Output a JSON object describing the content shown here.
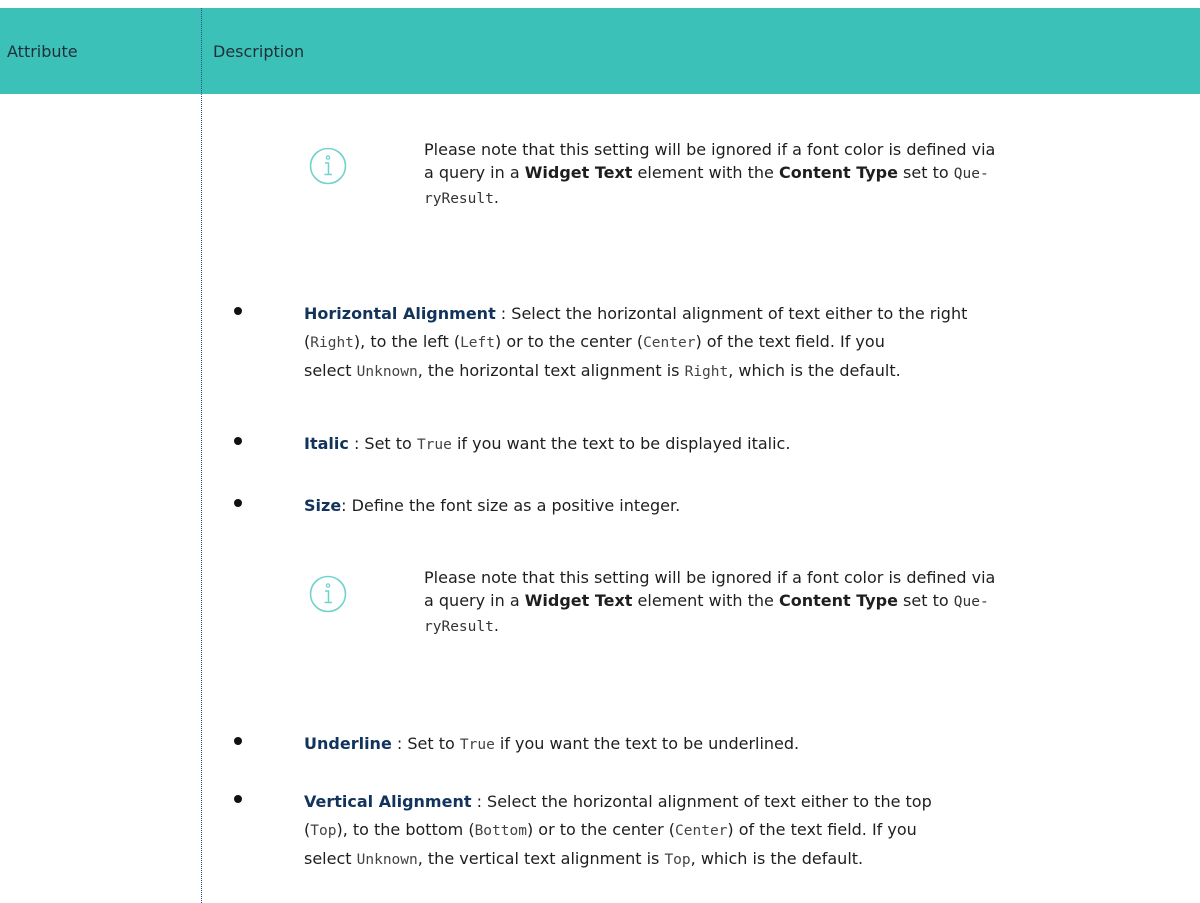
{
  "table": {
    "headers": {
      "attribute": "Attribute",
      "description": "Description"
    }
  },
  "notes": [
    {
      "icon": "info-icon",
      "line1": "Please note that this setting will be ignored if a font color is defined via",
      "l2a": "a query in a ",
      "l2b": "Widget Text",
      "l2c": " element with the ",
      "l2d": "Content Type",
      "l2e": " set to ",
      "l2f": "Que-",
      "line3": "ryResult",
      "line3end": "."
    },
    {
      "icon": "info-icon",
      "line1": "Please note that this setting will be ignored if a font color is defined via",
      "l2a": "a query in a ",
      "l2b": "Widget Text",
      "l2c": " element with the ",
      "l2d": "Content Type",
      "l2e": " set to ",
      "l2f": "Que-",
      "line3": "ryResult",
      "line3end": "."
    }
  ],
  "bullets": {
    "horizontal": {
      "term": "Horizontal Alignment",
      "l1a": " : Select the horizontal alignment of text either to the right",
      "l2a": "(",
      "l2b": "Right",
      "l2c": "), to the left (",
      "l2d": "Left",
      "l2e": ") or to the center (",
      "l2f": "Center",
      "l2g": ") of the text field. If you",
      "l3a": "select ",
      "l3b": "Unknown",
      "l3c": ", the horizontal text alignment is ",
      "l3d": "Right",
      "l3e": ", which is the default."
    },
    "italic": {
      "term": "Italic",
      "a": " : Set to ",
      "b": "True",
      "c": " if you want the text to be displayed italic."
    },
    "size": {
      "term": "Size",
      "a": ": Define the font size as a positive integer."
    },
    "underline": {
      "term": "Underline",
      "a": " : Set to ",
      "b": "True",
      "c": " if you want the text to be underlined."
    },
    "vertical": {
      "term": "Vertical Alignment",
      "l1a": " : Select the horizontal alignment of text either to the top",
      "l2a": "(",
      "l2b": "Top",
      "l2c": "), to the bottom (",
      "l2d": "Bottom",
      "l2e": ") or to the center (",
      "l2f": "Center",
      "l2g": ") of the text field. If you",
      "l3a": "select ",
      "l3b": "Unknown",
      "l3c": ", the vertical text alignment is ",
      "l3d": "Top",
      "l3e": ", which is the default."
    }
  },
  "colors": {
    "header_bg": "#3cc1b8",
    "term": "#12335c",
    "icon": "#3cc1b8"
  }
}
